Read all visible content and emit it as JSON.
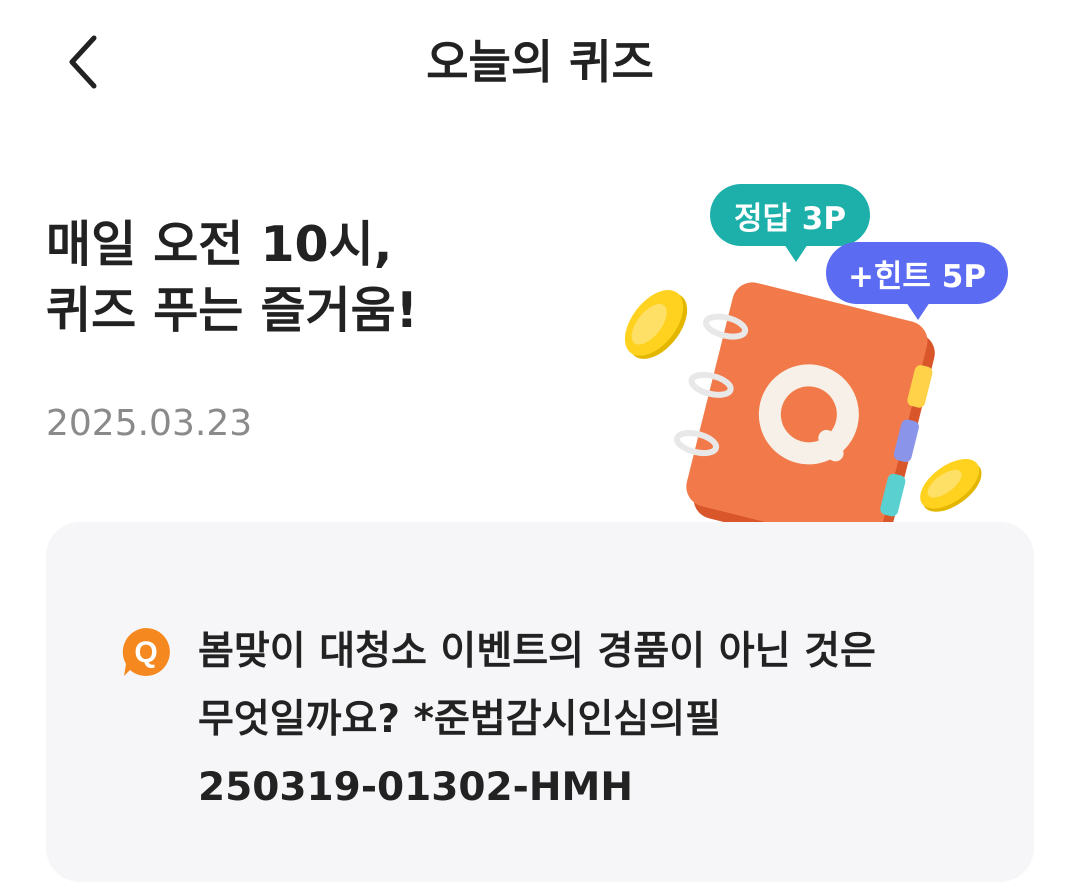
{
  "header": {
    "title": "오늘의 퀴즈"
  },
  "headline": {
    "line1": "매일 오전 10시,",
    "line2": "퀴즈 푸는 즐거움!"
  },
  "date": "2025.03.23",
  "bubbles": {
    "answer": "정답 3P",
    "hint": "+힌트 5P"
  },
  "illustration": {
    "book_letter": "Q"
  },
  "question": {
    "icon_letter": "Q",
    "line1": "봄맞이 대청소 이벤트의 경품이 아닌 것은",
    "line2": "무엇일까요? *준법감시인심의필",
    "line3": "250319-01302-HMH"
  },
  "colors": {
    "accent_orange": "#f27a2a",
    "answer_teal": "#1db0aa",
    "hint_purple": "#5c6cf2",
    "card_bg": "#f6f6f8",
    "date_gray": "#8a8a8a"
  }
}
